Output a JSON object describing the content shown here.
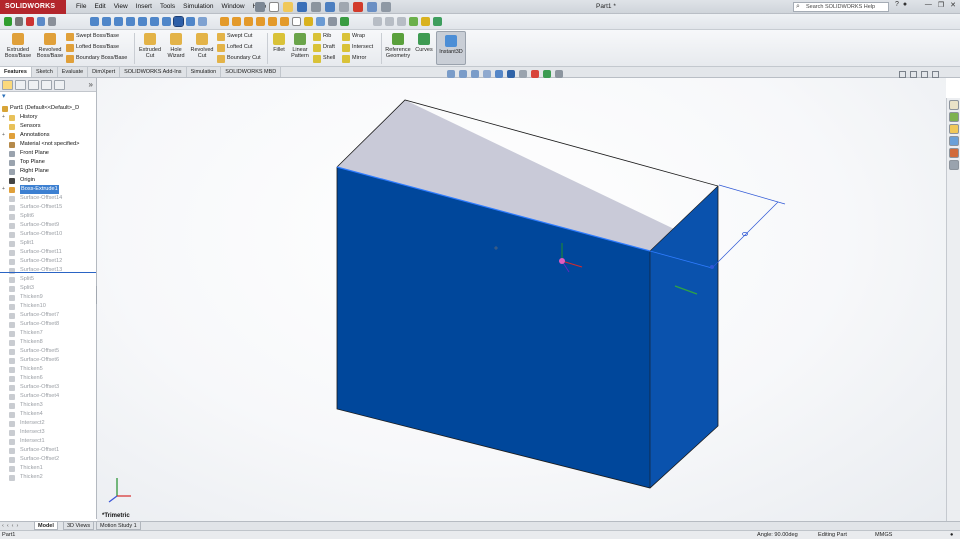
{
  "app": {
    "brand": "SOLIDWORKS",
    "document_title": "Part1 *",
    "search_placeholder": "Search SOLIDWORKS Help"
  },
  "menu": [
    "File",
    "Edit",
    "View",
    "Insert",
    "Tools",
    "Simulation",
    "Window",
    "Help"
  ],
  "ribbon": {
    "extruded_boss": "Extruded Boss/Base",
    "revolved_boss": "Revolved Boss/Base",
    "swept_boss": "Swept Boss/Base",
    "lofted_boss": "Lofted Boss/Base",
    "boundary_boss": "Boundary Boss/Base",
    "extruded_cut": "Extruded Cut",
    "hole_wizard": "Hole Wizard",
    "revolved_cut": "Revolved Cut",
    "swept_cut": "Swept Cut",
    "lofted_cut": "Lofted Cut",
    "boundary_cut": "Boundary Cut",
    "fillet": "Fillet",
    "linear_pattern": "Linear Pattern",
    "rib": "Rib",
    "draft": "Draft",
    "shell": "Shell",
    "wrap": "Wrap",
    "intersect": "Intersect",
    "mirror": "Mirror",
    "reference_geometry": "Reference Geometry",
    "curves": "Curves",
    "instant3d": "Instant3D"
  },
  "tabs": [
    "Features",
    "Sketch",
    "Evaluate",
    "DimXpert",
    "SOLIDWORKS Add-Ins",
    "Simulation",
    "SOLIDWORKS MBD"
  ],
  "tree": {
    "root": "Part1  (Default<<Default>_D",
    "items": [
      {
        "label": "History",
        "state": "normal",
        "expand": "+",
        "icon": "folder"
      },
      {
        "label": "Sensors",
        "state": "normal",
        "expand": "",
        "icon": "folder"
      },
      {
        "label": "Annotations",
        "state": "normal",
        "expand": "+",
        "icon": "annotation"
      },
      {
        "label": "Material <not specified>",
        "state": "normal",
        "expand": "",
        "icon": "material"
      },
      {
        "label": "Front Plane",
        "state": "normal",
        "expand": "",
        "icon": "plane"
      },
      {
        "label": "Top Plane",
        "state": "normal",
        "expand": "",
        "icon": "plane"
      },
      {
        "label": "Right Plane",
        "state": "normal",
        "expand": "",
        "icon": "plane"
      },
      {
        "label": "Origin",
        "state": "normal",
        "expand": "",
        "icon": "origin"
      },
      {
        "label": "Boss-Extrude1",
        "state": "selected",
        "expand": "+",
        "icon": "extrude"
      },
      {
        "label": "Surface-Offset14",
        "state": "suppressed",
        "expand": "",
        "icon": "surface"
      },
      {
        "label": "Surface-Offset15",
        "state": "suppressed",
        "expand": "",
        "icon": "surface"
      },
      {
        "label": "Split6",
        "state": "suppressed",
        "expand": "",
        "icon": "split"
      },
      {
        "label": "Surface-Offset9",
        "state": "suppressed",
        "expand": "",
        "icon": "surface"
      },
      {
        "label": "Surface-Offset10",
        "state": "suppressed",
        "expand": "",
        "icon": "surface"
      },
      {
        "label": "Split1",
        "state": "suppressed",
        "expand": "",
        "icon": "split"
      },
      {
        "label": "Surface-Offset11",
        "state": "suppressed",
        "expand": "",
        "icon": "surface"
      },
      {
        "label": "Surface-Offset12",
        "state": "suppressed",
        "expand": "",
        "icon": "surface"
      },
      {
        "label": "Surface-Offset13",
        "state": "suppressed",
        "expand": "",
        "icon": "surface"
      },
      {
        "label": "Split5",
        "state": "suppressed",
        "expand": "",
        "icon": "split"
      },
      {
        "label": "Split3",
        "state": "suppressed",
        "expand": "",
        "icon": "split"
      },
      {
        "label": "Thicken9",
        "state": "suppressed",
        "expand": "",
        "icon": "thicken"
      },
      {
        "label": "Thicken10",
        "state": "suppressed",
        "expand": "",
        "icon": "thicken"
      },
      {
        "label": "Surface-Offset7",
        "state": "suppressed",
        "expand": "",
        "icon": "surface"
      },
      {
        "label": "Surface-Offset8",
        "state": "suppressed",
        "expand": "",
        "icon": "surface"
      },
      {
        "label": "Thicken7",
        "state": "suppressed",
        "expand": "",
        "icon": "thicken"
      },
      {
        "label": "Thicken8",
        "state": "suppressed",
        "expand": "",
        "icon": "thicken"
      },
      {
        "label": "Surface-Offset5",
        "state": "suppressed",
        "expand": "",
        "icon": "surface"
      },
      {
        "label": "Surface-Offset6",
        "state": "suppressed",
        "expand": "",
        "icon": "surface"
      },
      {
        "label": "Thicken5",
        "state": "suppressed",
        "expand": "",
        "icon": "thicken"
      },
      {
        "label": "Thicken6",
        "state": "suppressed",
        "expand": "",
        "icon": "thicken"
      },
      {
        "label": "Surface-Offset3",
        "state": "suppressed",
        "expand": "",
        "icon": "surface"
      },
      {
        "label": "Surface-Offset4",
        "state": "suppressed",
        "expand": "",
        "icon": "surface"
      },
      {
        "label": "Thicken3",
        "state": "suppressed",
        "expand": "",
        "icon": "thicken"
      },
      {
        "label": "Thicken4",
        "state": "suppressed",
        "expand": "",
        "icon": "thicken"
      },
      {
        "label": "Intersect2",
        "state": "suppressed",
        "expand": "",
        "icon": "intersect"
      },
      {
        "label": "Intersect3",
        "state": "suppressed",
        "expand": "",
        "icon": "intersect"
      },
      {
        "label": "Intersect1",
        "state": "suppressed",
        "expand": "",
        "icon": "intersect"
      },
      {
        "label": "Surface-Offset1",
        "state": "suppressed",
        "expand": "",
        "icon": "surface"
      },
      {
        "label": "Surface-Offset2",
        "state": "suppressed",
        "expand": "",
        "icon": "surface"
      },
      {
        "label": "Thicken1",
        "state": "suppressed",
        "expand": "",
        "icon": "thicken"
      },
      {
        "label": "Thicken2",
        "state": "suppressed",
        "expand": "",
        "icon": "thicken"
      }
    ]
  },
  "viewport": {
    "view_name": "*Trimetric",
    "colors": {
      "face_top": "#c9cad8",
      "face_front": "#00479b",
      "face_right": "#0a52ad",
      "edge": "#1a1a1a",
      "highlight": "#2f7cff"
    }
  },
  "bottom_tabs": [
    "Model",
    "3D Views",
    "Motion Study 1"
  ],
  "status": {
    "left": "Part1",
    "angle": "Angle: 90.00deg",
    "mode": "Editing Part",
    "units": "MMGS"
  }
}
